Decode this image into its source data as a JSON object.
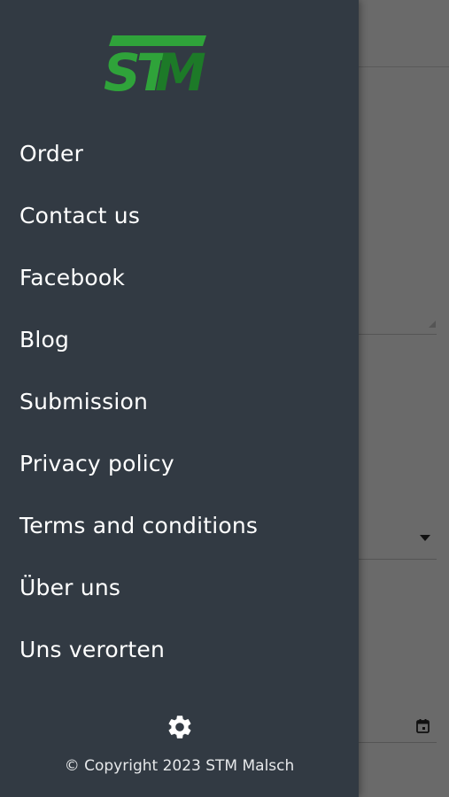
{
  "brand": {
    "logo_text": "STM",
    "colors": {
      "primary": "#2fa33a",
      "dark": "#1d7a28"
    }
  },
  "drawer": {
    "background": "#323a43",
    "menu": [
      {
        "label": "Order"
      },
      {
        "label": "Contact us"
      },
      {
        "label": "Facebook"
      },
      {
        "label": "Blog"
      },
      {
        "label": "Submission"
      },
      {
        "label": "Privacy policy"
      },
      {
        "label": "Terms and conditions"
      },
      {
        "label": "Über uns"
      },
      {
        "label": "Uns verorten"
      }
    ],
    "settings_icon": "gear-icon",
    "copyright": "© Copyright 2023 STM Malsch"
  },
  "background_app": {
    "icons": [
      "dropdown-caret-icon",
      "calendar-icon"
    ]
  }
}
